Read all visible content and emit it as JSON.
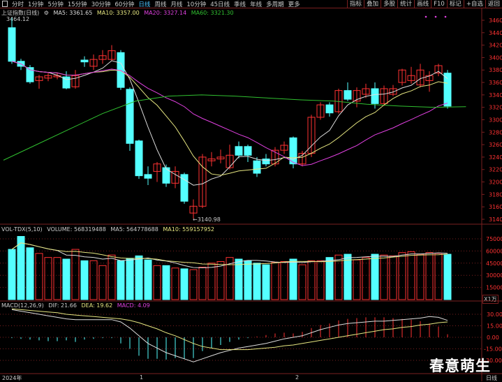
{
  "toolbar": {
    "periods": [
      "分时",
      "1分钟",
      "5分钟",
      "15分钟",
      "30分钟",
      "60分钟",
      "日线",
      "周线",
      "月线",
      "10分钟",
      "45日线",
      "季线",
      "年线",
      "多周期",
      "更多"
    ],
    "active": "日线",
    "right_buttons": [
      "指标",
      "叠加",
      "多股",
      "统计",
      "画线",
      "F10",
      "标记",
      "+自选",
      "返回"
    ]
  },
  "info": {
    "title": "上证指数(日线)",
    "ma5": "MA5: 3361.65",
    "ma10": "MA10: 3357.00",
    "ma20": "MA20: 3327.14",
    "ma60": "MA60: 3321.30",
    "high_label": "3464.12",
    "low_label": "←3140.98"
  },
  "volume_info": {
    "title": "VOL-TDX(5,10)",
    "volume": "VOLUME: 568319488",
    "ma5": "MA5: 564778688",
    "ma10": "MA10: 559157952",
    "unit": "X1万"
  },
  "macd_info": {
    "title": "MACD(12,26,9)",
    "dif": "DIF: 21.66",
    "dea": "DEA: 19.62",
    "macd": "MACD: 4.09"
  },
  "axis": {
    "price_ticks": [
      "3460",
      "3440",
      "3420",
      "3400",
      "3380",
      "3360",
      "3340",
      "3320",
      "3300",
      "3280",
      "3260",
      "3240",
      "3220",
      "3200",
      "3180",
      "3160",
      "3140"
    ],
    "volume_ticks": [
      "75000",
      "60000",
      "45000",
      "30000",
      "15000"
    ],
    "macd_ticks": [
      "30.00",
      "15.00",
      "0.00",
      "-15.00",
      "-30.00"
    ],
    "date_labels": [
      "2024年",
      "1",
      "2"
    ],
    "period_label": "日线"
  },
  "watermark": "春意萌生",
  "colors": {
    "up": "#ff3232",
    "down": "#54ffff",
    "ma5": "#dddddd",
    "ma10": "#e6e680",
    "ma20": "#e040e0",
    "ma60": "#30c030",
    "grid": "#7a1f1f"
  },
  "chart_data": {
    "type": "candlestick",
    "ohlc": [
      [
        3448,
        3394,
        3464,
        3390
      ],
      [
        3394,
        3386,
        3398,
        3380
      ],
      [
        3384,
        3361,
        3388,
        3358
      ],
      [
        3363,
        3369,
        3372,
        3350
      ],
      [
        3367,
        3371,
        3375,
        3362
      ],
      [
        3369,
        3371,
        3376,
        3365
      ],
      [
        3369,
        3351,
        3378,
        3349
      ],
      [
        3353,
        3371,
        3380,
        3350
      ],
      [
        3396,
        3393,
        3402,
        3385
      ],
      [
        3386,
        3397,
        3405,
        3380
      ],
      [
        3397,
        3403,
        3412,
        3390
      ],
      [
        3397,
        3411,
        3420,
        3395
      ],
      [
        3408,
        3352,
        3412,
        3348
      ],
      [
        3349,
        3262,
        3352,
        3250
      ],
      [
        3266,
        3210,
        3268,
        3205
      ],
      [
        3212,
        3206,
        3225,
        3195
      ],
      [
        3217,
        3229,
        3232,
        3200
      ],
      [
        3223,
        3198,
        3228,
        3192
      ],
      [
        3198,
        3217,
        3225,
        3190
      ],
      [
        3212,
        3169,
        3215,
        3165
      ],
      [
        3150,
        3161,
        3172,
        3141
      ],
      [
        3161,
        3240,
        3245,
        3158
      ],
      [
        3234,
        3237,
        3248,
        3225
      ],
      [
        3237,
        3240,
        3252,
        3230
      ],
      [
        3223,
        3243,
        3260,
        3220
      ],
      [
        3257,
        3243,
        3265,
        3238
      ],
      [
        3257,
        3243,
        3260,
        3232
      ],
      [
        3234,
        3214,
        3240,
        3208
      ],
      [
        3237,
        3229,
        3245,
        3225
      ],
      [
        3229,
        3251,
        3256,
        3225
      ],
      [
        3251,
        3259,
        3265,
        3245
      ],
      [
        3271,
        3229,
        3273,
        3222
      ],
      [
        3229,
        3246,
        3250,
        3225
      ],
      [
        3246,
        3304,
        3308,
        3240
      ],
      [
        3304,
        3324,
        3328,
        3300
      ],
      [
        3324,
        3311,
        3328,
        3305
      ],
      [
        3313,
        3347,
        3350,
        3310
      ],
      [
        3347,
        3333,
        3360,
        3330
      ],
      [
        3330,
        3347,
        3352,
        3320
      ],
      [
        3341,
        3350,
        3358,
        3335
      ],
      [
        3350,
        3326,
        3360,
        3318
      ],
      [
        3326,
        3350,
        3355,
        3322
      ],
      [
        3341,
        3350,
        3356,
        3338
      ],
      [
        3360,
        3380,
        3382,
        3355
      ],
      [
        3363,
        3371,
        3385,
        3358
      ],
      [
        3356,
        3380,
        3390,
        3352
      ],
      [
        3363,
        3371,
        3378,
        3345
      ],
      [
        3375,
        3387,
        3390,
        3370
      ],
      [
        3375,
        3322,
        3380,
        3318
      ]
    ],
    "ma60": [
      3235,
      3260,
      3285,
      3310,
      3330,
      3338,
      3340,
      3338,
      3335,
      3332,
      3330,
      3325,
      3322,
      3320,
      3321
    ],
    "volume": [
      62000,
      78000,
      64000,
      57000,
      52000,
      52000,
      50000,
      62000,
      48000,
      48000,
      42000,
      55000,
      48000,
      51000,
      54000,
      49000,
      42000,
      42000,
      39000,
      38000,
      37000,
      40000,
      45000,
      47000,
      52000,
      50000,
      48000,
      45000,
      43000,
      46000,
      47000,
      50000,
      43000,
      48000,
      48000,
      52000,
      55000,
      56000,
      49000,
      52000,
      56000,
      55000,
      54000,
      58000,
      59000,
      56000,
      58000,
      57000,
      56000
    ],
    "macd_hist": [
      -1,
      -2,
      -3,
      -4,
      -5,
      -5,
      -4,
      -6,
      -3,
      -2,
      -1,
      -1,
      -8,
      -15,
      -24,
      -28,
      -28,
      -29,
      -27,
      -28,
      -27,
      -18,
      -14,
      -10,
      -6,
      -3,
      -1,
      1,
      3,
      5,
      6,
      5,
      7,
      12,
      16,
      18,
      22,
      24,
      25,
      26,
      26,
      26,
      25,
      24,
      23,
      21,
      18,
      14,
      4
    ],
    "dif": [
      36,
      34,
      32,
      30,
      28,
      26,
      24,
      23,
      23,
      23,
      23,
      23,
      20,
      12,
      2,
      -8,
      -14,
      -20,
      -24,
      -28,
      -32,
      -28,
      -24,
      -20,
      -17,
      -14,
      -12,
      -10,
      -8,
      -5,
      -2,
      0,
      2,
      6,
      10,
      13,
      16,
      18,
      19,
      20,
      21,
      21,
      22,
      23,
      24,
      25,
      27,
      26,
      22
    ],
    "dea": [
      37,
      36,
      35,
      34,
      33,
      32,
      30,
      29,
      28,
      27,
      26,
      25,
      24,
      22,
      19,
      15,
      11,
      6,
      2,
      -3,
      -8,
      -12,
      -14,
      -16,
      -16,
      -16,
      -16,
      -15,
      -14,
      -13,
      -11,
      -10,
      -8,
      -6,
      -4,
      -2,
      0,
      2,
      4,
      6,
      8,
      10,
      11,
      13,
      14,
      16,
      17,
      19,
      20
    ]
  }
}
